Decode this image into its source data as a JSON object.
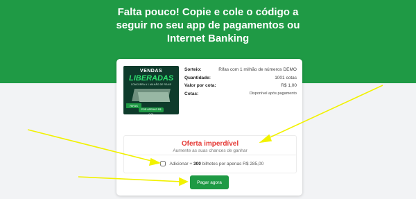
{
  "header": {
    "line1": "Falta pouco! Copie e cole o código a",
    "line2": "seguir no seu app de pagamentos ou",
    "line3": "Internet Banking"
  },
  "product_image": {
    "title_top": "VENDAS",
    "title_main": "LIBERADAS",
    "subtitle": "CONCORRA A 1 MILHÃO DE REAIS",
    "logo_text": "RIFAS",
    "price_text": "POR APENAS R$ 0,01"
  },
  "details": [
    {
      "key": "Sorteio:",
      "value": "Rifas com 1 milhão de números DEMO"
    },
    {
      "key": "Quantidade:",
      "value": "1001 cotas"
    },
    {
      "key": "Valor por cota:",
      "value": "R$ 1,00"
    },
    {
      "key": "Cotas:",
      "value": "Disponível após pagamento"
    }
  ],
  "offer": {
    "title": "Oferta imperdível",
    "subtitle": "Aumente as suas chances de ganhar",
    "checkbox_prefix": "Adicionar +",
    "checkbox_amount": "300",
    "checkbox_suffix": "bilhetes por apenas R$ 285,00",
    "checked": false
  },
  "actions": {
    "pay_label": "Pagar agora"
  },
  "colors": {
    "header_bg": "#1f9a45",
    "button_bg": "#1e9a44",
    "offer_title": "#e53935",
    "annotation_arrow": "#f2f200"
  }
}
